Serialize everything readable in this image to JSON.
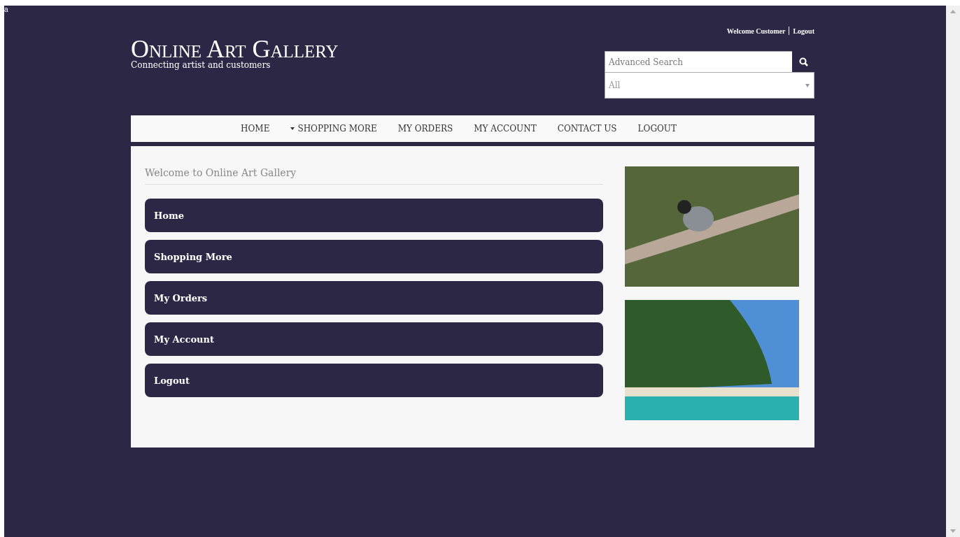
{
  "corner_mark": "a",
  "header": {
    "title": "Online Art Gallery",
    "tagline": "Connecting artist and customers",
    "welcome": "Welcome Customer",
    "logout": "Logout",
    "search": {
      "placeholder": "Advanced Search"
    },
    "category": {
      "value": "All"
    }
  },
  "nav": [
    {
      "label": "HOME",
      "dropdown": false
    },
    {
      "label": "SHOPPING MORE",
      "dropdown": true
    },
    {
      "label": "MY ORDERS",
      "dropdown": false
    },
    {
      "label": "MY ACCOUNT",
      "dropdown": false
    },
    {
      "label": "CONTACT US",
      "dropdown": false
    },
    {
      "label": "LOGOUT",
      "dropdown": false
    }
  ],
  "content": {
    "heading": "Welcome to Online Art Gallery",
    "menu": [
      "Home",
      "Shopping More",
      "My Orders",
      "My Account",
      "Logout"
    ]
  },
  "photos": [
    {
      "kind": "bird"
    },
    {
      "kind": "beach"
    }
  ]
}
